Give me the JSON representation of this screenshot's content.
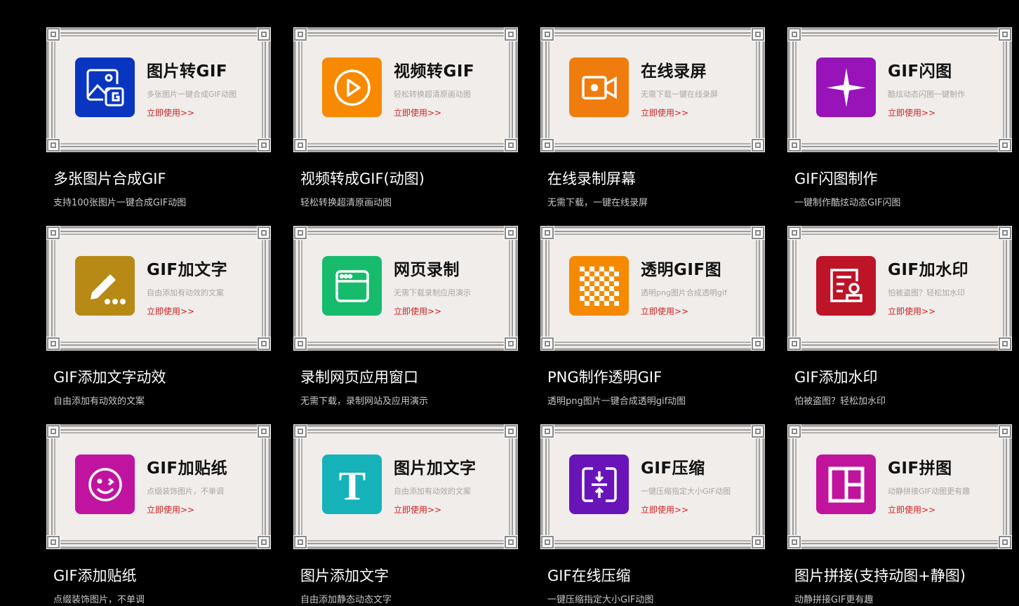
{
  "cta": "立即使用>>",
  "tools": [
    {
      "id": "img2gif",
      "title": "图片转GIF",
      "desc": "多张图片一键合成GIF动图",
      "caption": "多张图片合成GIF",
      "subcaption": "支持100张图片一键合成GIF动图",
      "color": "#0a35c0",
      "icon": "image-gif-icon"
    },
    {
      "id": "video2gif",
      "title": "视频转GIF",
      "desc": "轻松转换超清原画动图",
      "caption": "视频转成GIF(动图)",
      "subcaption": "轻松转换超清原画动图",
      "color": "#f78a00",
      "icon": "play-icon"
    },
    {
      "id": "screenrec",
      "title": "在线录屏",
      "desc": "无需下载一键在线录屏",
      "caption": "在线录制屏幕",
      "subcaption": "无需下载，一键在线录屏",
      "color": "#f07c0e",
      "icon": "video-camera-icon"
    },
    {
      "id": "flash",
      "title": "GIF闪图",
      "desc": "酷炫动态闪图一键制作",
      "caption": "GIF闪图制作",
      "subcaption": "一键制作酷炫动态GIF闪图",
      "color": "#9814b8",
      "icon": "sparkle-icon"
    },
    {
      "id": "addtext",
      "title": "GIF加文字",
      "desc": "自由添加有动效的文案",
      "caption": "GIF添加文字动效",
      "subcaption": "自由添加有动效的文案",
      "color": "#b68a14",
      "icon": "pencil-icon"
    },
    {
      "id": "webrec",
      "title": "网页录制",
      "desc": "无需下载录制应用演示",
      "caption": "录制网页应用窗口",
      "subcaption": "无需下载，录制网站及应用演示",
      "color": "#16bc6b",
      "icon": "browser-window-icon"
    },
    {
      "id": "transparent",
      "title": "透明GIF图",
      "desc": "透明png图片合成透明gif",
      "caption": "PNG制作透明GIF",
      "subcaption": "透明png图片一键合成透明gif动图",
      "color": "#f58a00",
      "icon": "checkerboard-icon"
    },
    {
      "id": "watermark",
      "title": "GIF加水印",
      "desc": "怕被盗图？轻松加水印",
      "caption": "GIF添加水印",
      "subcaption": "怕被盗图？轻松加水印",
      "color": "#be1428",
      "icon": "stamp-icon"
    },
    {
      "id": "sticker",
      "title": "GIF加贴纸",
      "desc": "点缀装饰图片，不单调",
      "caption": "GIF添加贴纸",
      "subcaption": "点缀装饰图片，不单调",
      "color": "#c014a0",
      "icon": "smiley-icon"
    },
    {
      "id": "imgtext",
      "title": "图片加文字",
      "desc": "自由添加有动效的文案",
      "caption": "图片添加文字",
      "subcaption": "自由添加静态动态文字",
      "color": "#15b2ba",
      "icon": "text-t-icon"
    },
    {
      "id": "compress",
      "title": "GIF压缩",
      "desc": "一键压缩指定大小GIF动图",
      "caption": "GIF在线压缩",
      "subcaption": "一键压缩指定大小GIF动图",
      "color": "#6814b8",
      "icon": "compress-icon"
    },
    {
      "id": "collage",
      "title": "GIF拼图",
      "desc": "动静拼接GIF动图更有趣",
      "caption": "图片拼接(支持动图+静图)",
      "subcaption": "动静拼接GIF更有趣",
      "color": "#c0149c",
      "icon": "collage-layout-icon"
    }
  ]
}
